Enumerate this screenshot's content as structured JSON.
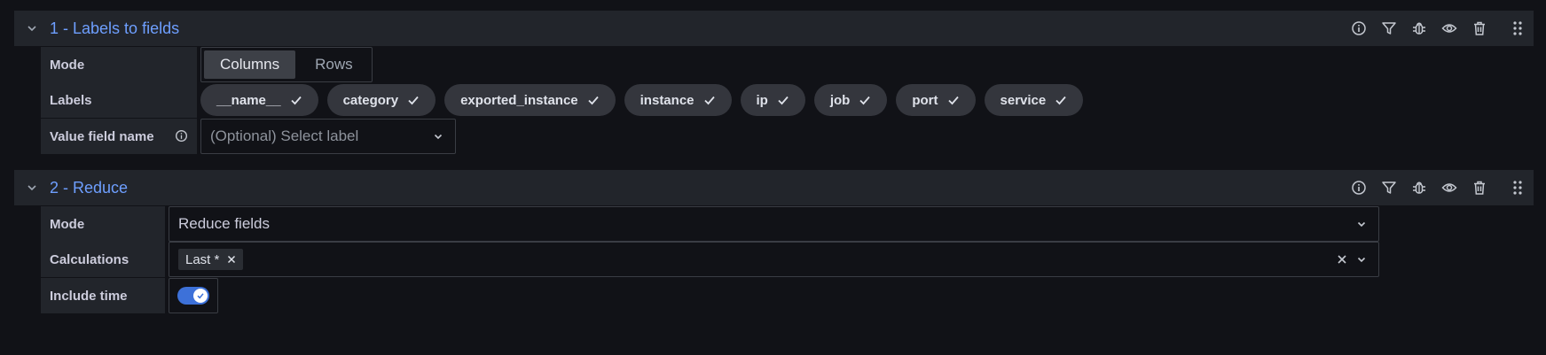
{
  "transforms": [
    {
      "title": "1 - Labels to fields",
      "mode_label": "Mode",
      "mode_options": [
        "Columns",
        "Rows"
      ],
      "mode_selected": "Columns",
      "labels_label": "Labels",
      "labels": [
        "__name__",
        "category",
        "exported_instance",
        "instance",
        "ip",
        "job",
        "port",
        "service"
      ],
      "value_field_label": "Value field name",
      "value_field_placeholder": "(Optional) Select label"
    },
    {
      "title": "2 - Reduce",
      "mode_label": "Mode",
      "mode_value": "Reduce fields",
      "calculations_label": "Calculations",
      "calculations": [
        "Last *"
      ],
      "include_time_label": "Include time",
      "include_time": true
    }
  ],
  "action_icons": [
    "info-icon",
    "filter-icon",
    "debug-icon",
    "eye-icon",
    "trash-icon",
    "drag-handle-icon"
  ],
  "colors": {
    "title": "#6e9fff",
    "toggle_on": "#3d71d9",
    "background": "#111217",
    "panel": "#22252b"
  }
}
